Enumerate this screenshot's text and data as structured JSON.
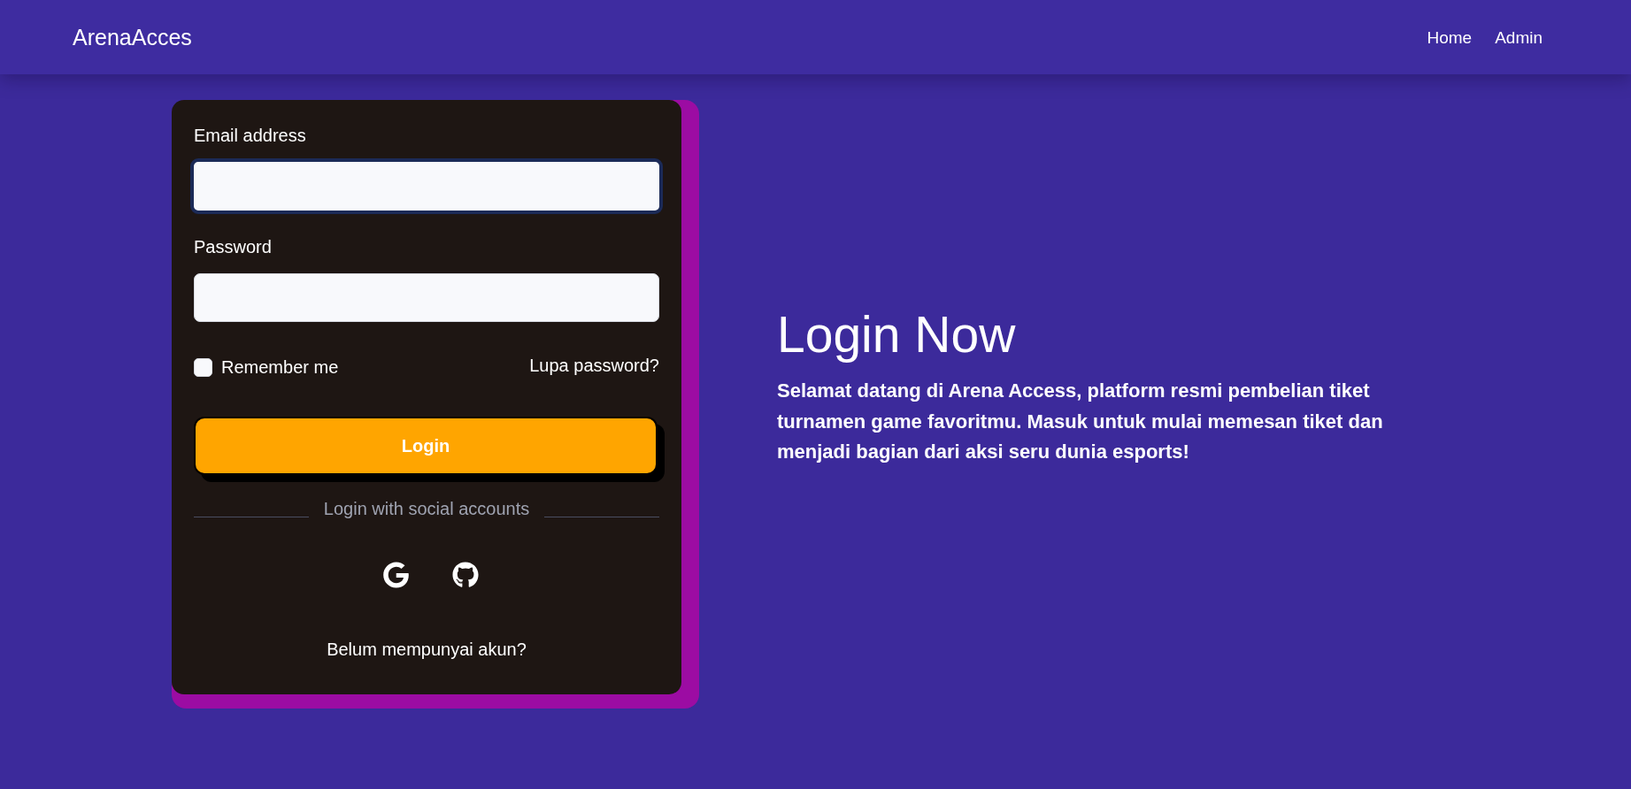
{
  "navbar": {
    "brand": "ArenaAcces",
    "links": [
      {
        "label": "Home"
      },
      {
        "label": "Admin"
      }
    ]
  },
  "login_card": {
    "fields": [
      {
        "label": "Email address",
        "focused": true
      },
      {
        "label": "Password",
        "focused": false
      }
    ],
    "remember_me": {
      "label": "Remember me",
      "checked": false
    },
    "forgot_password": "Lupa password?",
    "login_button": "Login",
    "social_divider": "Login with social accounts",
    "social_buttons": [
      {
        "kind": "google"
      },
      {
        "kind": "github"
      }
    ],
    "signup_link": "Belum mempunyai akun?"
  },
  "hero": {
    "title": "Login Now",
    "text": "Selamat datang di Arena Access, platform resmi pembelian tiket turnamen game favoritmu. Masuk untuk mulai memesan tiket dan menjadi bagian dari aksi seru dunia esports!"
  }
}
